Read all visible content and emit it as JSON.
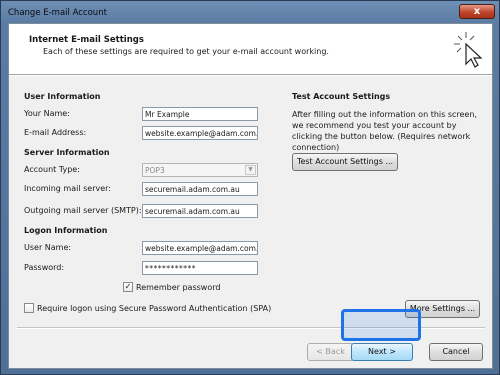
{
  "window": {
    "title": "Change E-mail Account",
    "close_label": "x"
  },
  "header": {
    "title": "Internet E-mail Settings",
    "subtitle": "Each of these settings are required to get your e-mail account working."
  },
  "user_info": {
    "section": "User Information",
    "name_label": "Your Name:",
    "name_value": "Mr Example",
    "email_label": "E-mail Address:",
    "email_value": "website.example@adam.com.au"
  },
  "server_info": {
    "section": "Server Information",
    "account_type_label": "Account Type:",
    "account_type_value": "POP3",
    "incoming_label": "Incoming mail server:",
    "incoming_value": "securemail.adam.com.au",
    "outgoing_label": "Outgoing mail server (SMTP):",
    "outgoing_value": "securemail.adam.com.au"
  },
  "logon_info": {
    "section": "Logon Information",
    "username_label": "User Name:",
    "username_value": "website.example@adam.com.au",
    "password_label": "Password:",
    "password_value": "************",
    "remember_label": "Remember password",
    "remember_checked": true,
    "spa_label": "Require logon using Secure Password Authentication (SPA)",
    "spa_checked": false
  },
  "test_settings": {
    "section": "Test Account Settings",
    "description": "After filling out the information on this screen, we recommend you test your account by clicking the button below. (Requires network connection)",
    "button_label": "Test Account Settings ..."
  },
  "buttons": {
    "more_settings": "More Settings ...",
    "back": "< Back",
    "next": "Next >",
    "cancel": "Cancel"
  },
  "colors": {
    "highlight": "#1e74e6",
    "close_button": "#c1452c"
  }
}
